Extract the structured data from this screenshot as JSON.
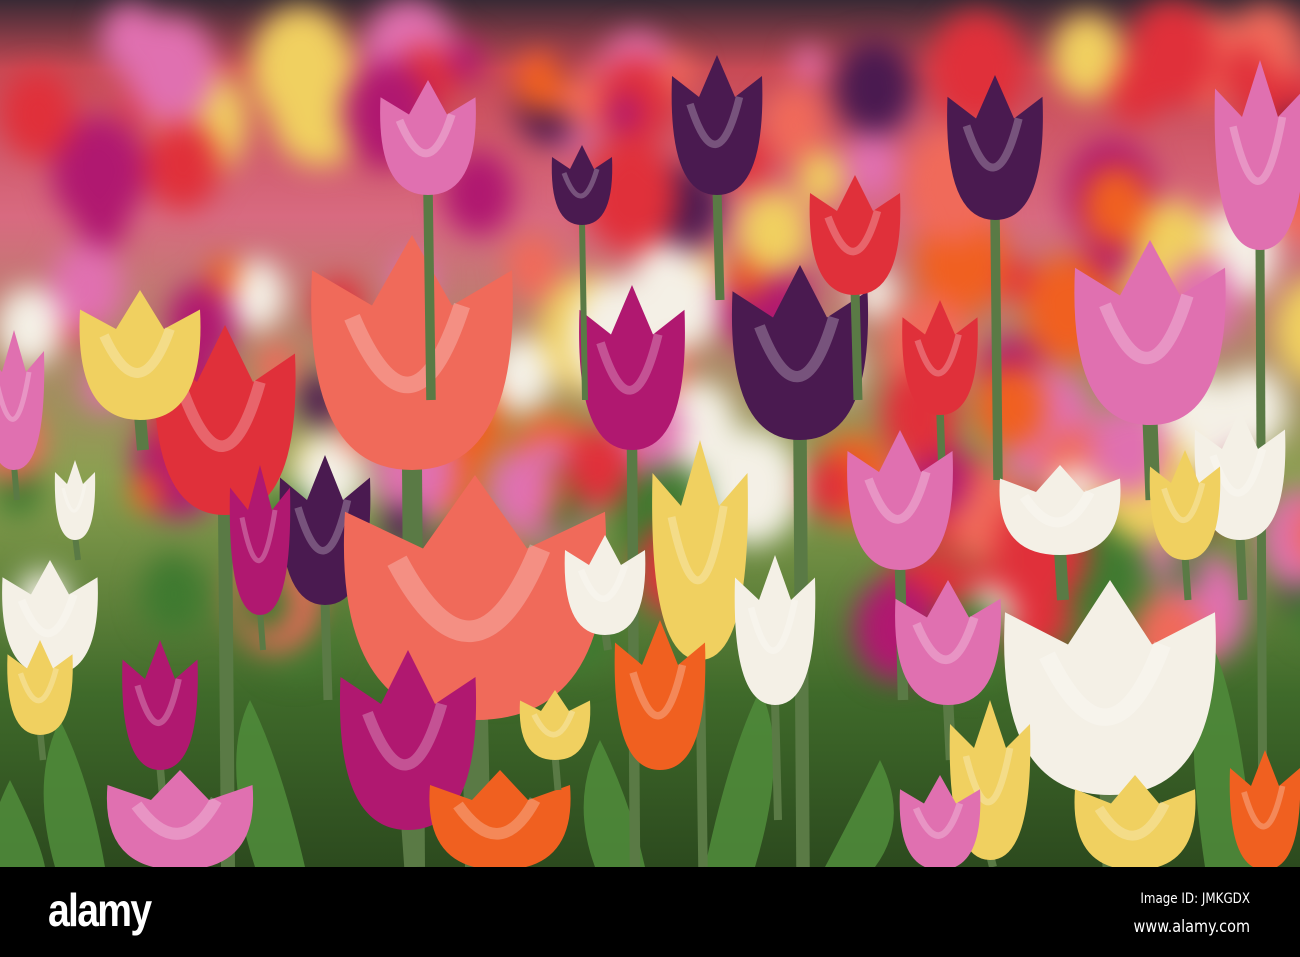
{
  "photo": {
    "subject": "tulip field",
    "palette": {
      "red": "#e0303a",
      "coral": "#f06a5a",
      "pink": "#e070b0",
      "magenta": "#b01870",
      "purple": "#4a1a50",
      "white": "#f4f0e6",
      "yellow": "#f0d060",
      "orange": "#f06020",
      "leaf": "#3f7a30"
    }
  },
  "watermark": {
    "logo": "alamy",
    "image_id": "Image ID: JMKGDX",
    "url": "www.alamy.com"
  }
}
